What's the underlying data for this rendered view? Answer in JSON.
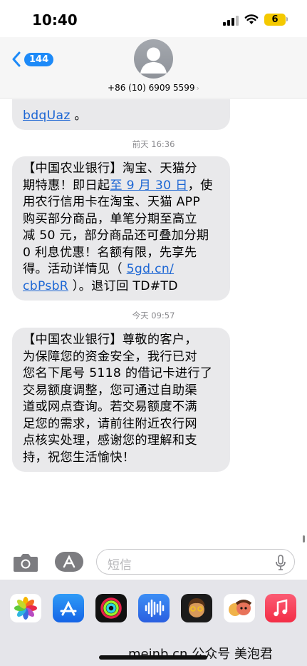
{
  "status_bar": {
    "time": "10:40",
    "battery": "6"
  },
  "header": {
    "back_count": "144",
    "contact_number": "+86 (10) 6909 5599",
    "contact_chevron": "›"
  },
  "messages": {
    "partial_bubble": {
      "link": "bdqUaz",
      "suffix": " 。"
    },
    "ts1": "前天 16:36",
    "msg1": {
      "l1": "【中国农业银行】淘宝、天猫分",
      "l2_pre": "期特惠！即日起",
      "l2_link": "至 9 月 30 日",
      "l2_post": "，使",
      "l3": "用农行信用卡在淘宝、天猫 APP",
      "l4": "购买部分商品，单笔分期至高立",
      "l5": "减 50 元，部分商品还可叠加分期",
      "l6": "0 利息优惠！名额有限，先享先",
      "l7_pre": "得。活动详情见（ ",
      "l7_link": "5gd.cn/",
      "l8_link": "cbPsbR",
      "l8_post": " ）。退订回 TD#TD"
    },
    "ts2": "今天 09:57",
    "msg2": {
      "l1": "【中国农业银行】尊敬的客户，",
      "l2": "为保障您的资金安全，我行已对",
      "l3": "您名下尾号 5118 的借记卡进行了",
      "l4": "交易额度调整，您可通过自助渠",
      "l5": "道或网点查询。若交易额度不满",
      "l6": "足您的需求，请前往附近农行网",
      "l7": "点核实处理，感谢您的理解和支",
      "l8": "持，祝您生活愉快！"
    }
  },
  "compose": {
    "placeholder": "短信"
  },
  "drawer": {
    "apps": [
      "photos-icon",
      "app-store-icon",
      "fitness-icon",
      "audio-icon",
      "memoji-icon",
      "memoji-stickers-icon",
      "music-icon"
    ],
    "watermark": "meinb.cn 公众号 美泡君"
  },
  "colors": {
    "bubble": "#e9e9eb",
    "link": "#1c66d4",
    "badge": "#1d8af8",
    "battery": "#f4c900",
    "drawer": "#e5e5ea"
  }
}
